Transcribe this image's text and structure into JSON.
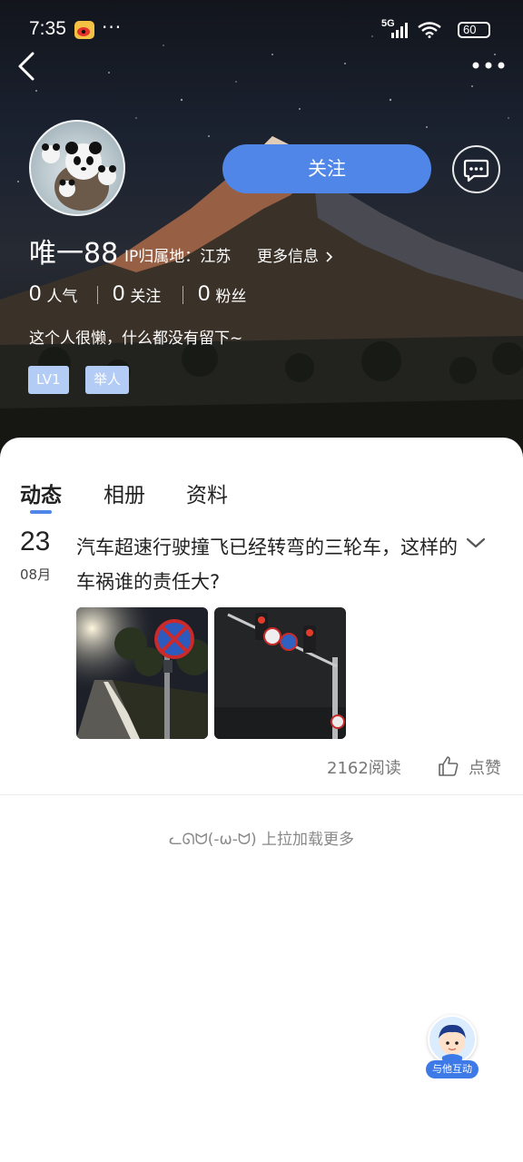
{
  "status_bar": {
    "time": "7:35",
    "dots": "···",
    "network": "5G",
    "battery": "60"
  },
  "profile": {
    "username": "唯一88",
    "ip_location": "IP归属地：江苏",
    "more_info": "更多信息",
    "follow_label": "关注",
    "stats": [
      {
        "value": "0",
        "label": "人气"
      },
      {
        "value": "0",
        "label": "关注"
      },
      {
        "value": "0",
        "label": "粉丝"
      }
    ],
    "bio": "这个人很懒，什么都没有留下~",
    "badges": [
      "LV1",
      "举人"
    ]
  },
  "tabs": [
    "动态",
    "相册",
    "资料"
  ],
  "active_tab": "动态",
  "post": {
    "day": "23",
    "month": "08月",
    "title": "汽车超速行驶撞飞已经转弯的三轮车，这样的车祸谁的责任大?",
    "reads": "2162阅读",
    "like_label": "点赞"
  },
  "load_more": "ᓚᘏᗢ(-ω-ᗢ) 上拉加载更多",
  "fab": {
    "label": "与他互动",
    "icon": "avatar-boy-icon"
  },
  "colors": {
    "accent": "#4f86e8",
    "badge_bg": "#b3ccf5",
    "text_dark": "#222222",
    "text_muted": "#777777"
  }
}
